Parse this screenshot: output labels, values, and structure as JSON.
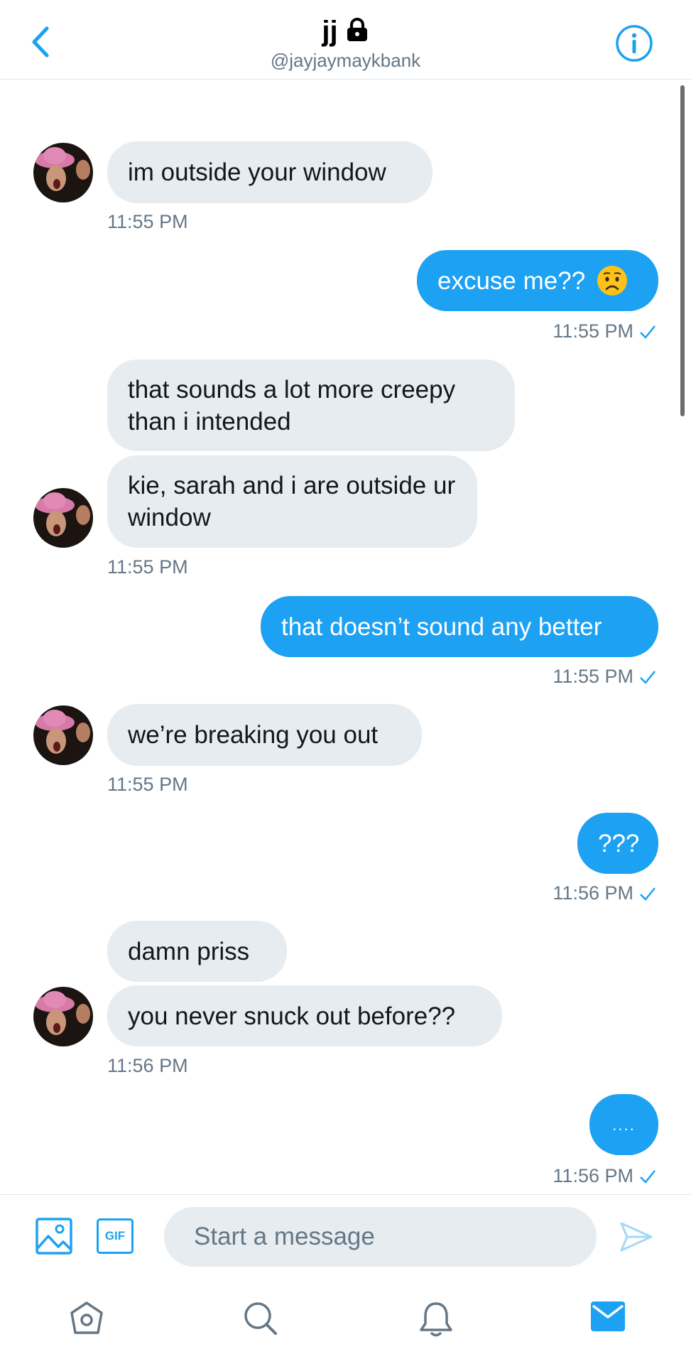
{
  "header": {
    "name": "jj",
    "handle": "@jayjaymaykbank"
  },
  "messages": [
    {
      "from": "them",
      "text": "im outside your window"
    },
    {
      "from": "them",
      "time": "11:55 PM"
    },
    {
      "from": "me",
      "text": "excuse me??",
      "emoji": "worried-face"
    },
    {
      "from": "me",
      "time": "11:55 PM"
    },
    {
      "from": "them",
      "text": "that sounds a lot more creepy than i intended"
    },
    {
      "from": "them",
      "text": "kie, sarah and i are outside ur window"
    },
    {
      "from": "them",
      "time": "11:55 PM"
    },
    {
      "from": "me",
      "text": "that doesn’t sound any better"
    },
    {
      "from": "me",
      "time": "11:55 PM"
    },
    {
      "from": "them",
      "text": "we’re breaking you out"
    },
    {
      "from": "them",
      "time": "11:55 PM"
    },
    {
      "from": "me",
      "text": "???"
    },
    {
      "from": "me",
      "time": "11:56 PM"
    },
    {
      "from": "them",
      "text": "damn priss"
    },
    {
      "from": "them",
      "text": "you never snuck out before??"
    },
    {
      "from": "them",
      "time": "11:56 PM"
    },
    {
      "from": "me",
      "text": "...."
    },
    {
      "from": "me",
      "time": "11:56 PM"
    }
  ],
  "composer": {
    "placeholder": "Start a message",
    "gif_label": "GIF"
  },
  "colors": {
    "accent": "#1da1f2",
    "received_bubble": "#e6ecf0",
    "muted_text": "#657786"
  },
  "icons": [
    "back-chevron-icon",
    "lock-icon",
    "info-icon",
    "image-icon",
    "gif-icon",
    "send-icon",
    "home-icon",
    "search-icon",
    "notifications-icon",
    "messages-icon"
  ]
}
